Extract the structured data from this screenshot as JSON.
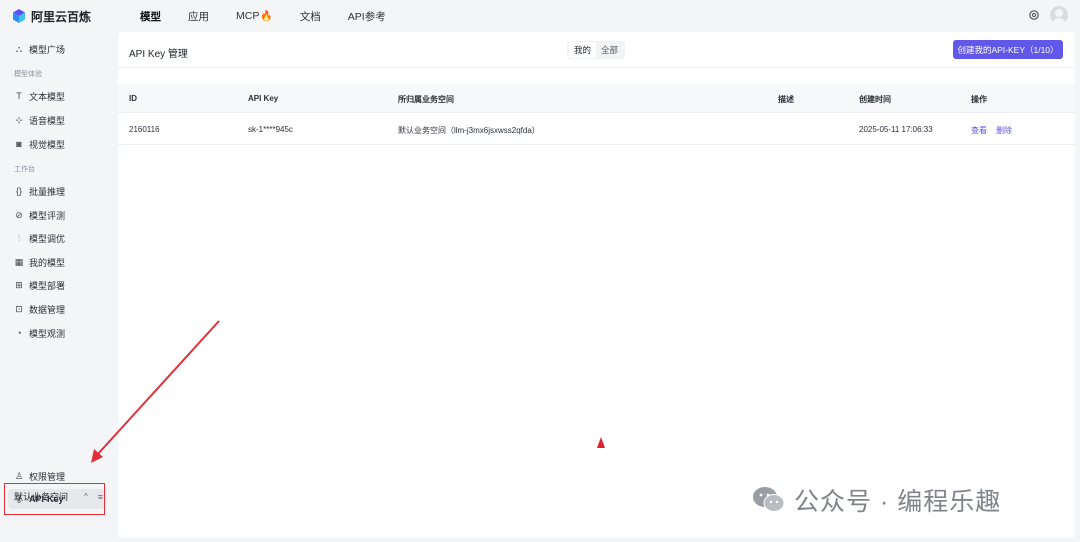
{
  "app": {
    "logo_text": "阿里云百炼"
  },
  "topnav": {
    "items": [
      "模型",
      "应用",
      "MCP",
      "文档",
      "API参考"
    ],
    "mcp_badge": "🔥"
  },
  "sidebar": {
    "items": [
      {
        "label": "模型广场",
        "icon": "cube-icon"
      },
      {
        "group": "模型体验"
      },
      {
        "label": "文本模型",
        "icon": "text-icon"
      },
      {
        "label": "语音模型",
        "icon": "waveform-icon"
      },
      {
        "label": "视觉模型",
        "icon": "camera-icon"
      },
      {
        "group": "工作台"
      },
      {
        "label": "批量推理",
        "icon": "braces-icon"
      },
      {
        "label": "模型评测",
        "icon": "compass-icon"
      },
      {
        "label": "模型调优",
        "icon": "sliders-icon"
      },
      {
        "label": "我的模型",
        "icon": "grid-icon"
      },
      {
        "label": "模型部署",
        "icon": "deploy-icon"
      },
      {
        "label": "数据管理",
        "icon": "chart-icon"
      },
      {
        "label": "模型观测",
        "icon": "pie-icon"
      }
    ],
    "bottom": {
      "permissions": "权限管理",
      "api_key": "API-Key"
    },
    "workspace": "默认业务空间",
    "workspace_caret": "^",
    "workspace_menu": "≡"
  },
  "main": {
    "title": "API Key 管理",
    "toggle": {
      "mine": "我的",
      "all": "全部"
    },
    "create_button": "创建我的API-KEY（1/10）",
    "table": {
      "headers": [
        "ID",
        "API Key",
        "所归属业务空间",
        "描述",
        "创建时间",
        "操作"
      ],
      "rows": [
        {
          "id": "2160116",
          "key": "sk-1****945c",
          "workspace": "默认业务空间（llm-j3mx6jsxwss2qfda）",
          "description": "",
          "created": "2025-05-11 17:06:33",
          "actions": [
            "查看",
            "删除"
          ]
        }
      ]
    }
  },
  "watermark": {
    "text": "公众号 · 编程乐趣"
  },
  "colors": {
    "accent": "#6157e8",
    "annotation": "#e0303a"
  }
}
